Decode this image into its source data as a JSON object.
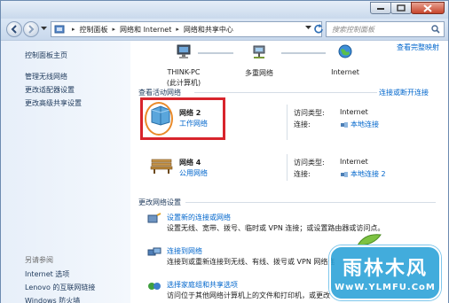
{
  "address_bar": {
    "crumbs": [
      "控制面板",
      "网络和 Internet",
      "网络和共享中心"
    ],
    "search_placeholder": "搜索控制面板"
  },
  "sidebar": {
    "home": "控制面板主页",
    "tasks": [
      "管理无线网络",
      "更改适配器设置",
      "更改高级共享设置"
    ],
    "see_also_title": "另请参阅",
    "see_also": [
      "Internet 选项",
      "Lenovo 的互联网链接",
      "Windows 防火墙"
    ]
  },
  "map": {
    "full_map_link": "查看完整映射",
    "nodes": [
      {
        "line1": "THINK-PC",
        "line2": "(此计算机)"
      },
      {
        "line1": "多重网络",
        "line2": ""
      },
      {
        "line1": "Internet",
        "line2": ""
      }
    ]
  },
  "active_networks": {
    "title": "查看活动网络",
    "connect_link": "连接或断开连接",
    "networks": [
      {
        "name": "网络  2",
        "type": "工作网络",
        "access_label": "访问类型:",
        "access_value": "Internet",
        "conn_label": "连接:",
        "conn_value": "本地连接"
      },
      {
        "name": "网络  4",
        "type": "公用网络",
        "access_label": "访问类型:",
        "access_value": "Internet",
        "conn_label": "连接:",
        "conn_value": "本地连接 2"
      }
    ]
  },
  "change_settings": {
    "title": "更改网络设置",
    "items": [
      {
        "title": "设置新的连接或网络",
        "desc": "设置无线、宽带、拨号、临时或 VPN 连接；或设置路由器或访问点。"
      },
      {
        "title": "连接到网络",
        "desc": "连接到或重新连接到无线、有线、拨号或 VPN 网络连"
      },
      {
        "title": "选择家庭组和共享选项",
        "desc": "访问位于其他网络计算机上的文件和打印机，或更改"
      }
    ]
  },
  "watermark": {
    "top": "雨林木风",
    "bottom": "WwW.YLMFU.CoM"
  },
  "colors": {
    "link": "#0066cc",
    "highlight_box": "#d8242c",
    "highlight_circle": "#e98a2a",
    "watermark_bg": "#28a0d7"
  }
}
